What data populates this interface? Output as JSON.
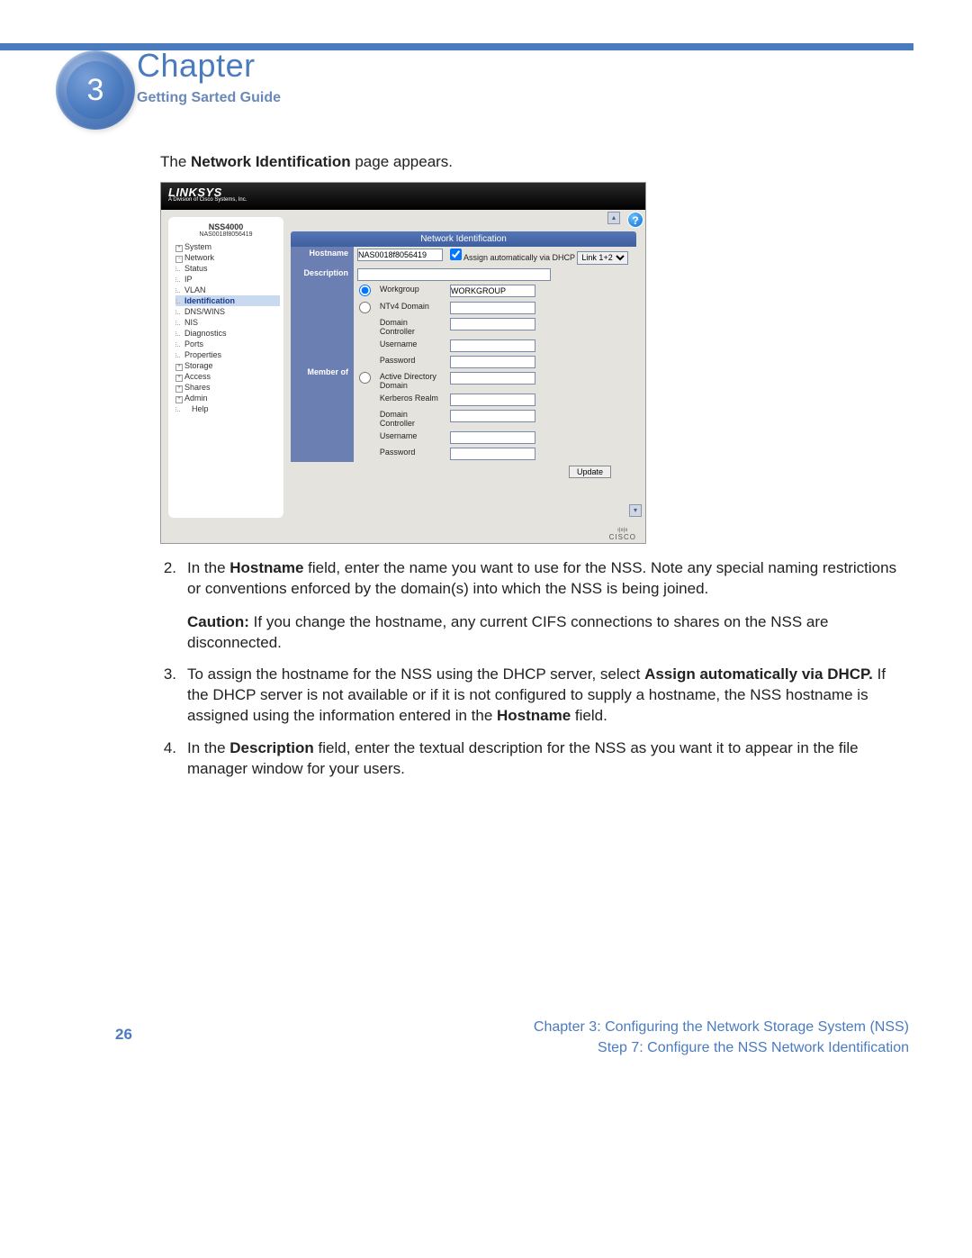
{
  "header": {
    "chapter_label": "Chapter",
    "chapter_number": "3",
    "subtitle": "Getting Sarted Guide"
  },
  "intro": {
    "pre": "The ",
    "bold": "Network Identification",
    "post": " page appears."
  },
  "screenshot": {
    "brand": "LINKSYS",
    "brand_tag": "A Division of Cisco Systems, Inc.",
    "device": "NSS4000",
    "device_sub": "NAS0018f8056419",
    "help_symbol": "?",
    "nav": {
      "system": "System",
      "network": "Network",
      "status": "Status",
      "ip": "IP",
      "vlan": "VLAN",
      "identification": "Identification",
      "dnswins": "DNS/WINS",
      "nis": "NIS",
      "diagnostics": "Diagnostics",
      "ports": "Ports",
      "properties": "Properties",
      "storage": "Storage",
      "access": "Access",
      "shares": "Shares",
      "admin": "Admin",
      "help": "Help"
    },
    "panel_title": "Network Identification",
    "form": {
      "hostname_label": "Hostname",
      "hostname_value": "NAS0018f8056419",
      "assign_auto": "Assign automatically via DHCP",
      "dhcp_select": "Link 1+2",
      "description_label": "Description",
      "description_value": "",
      "member_of_label": "Member of",
      "workgroup_label": "Workgroup",
      "workgroup_value": "WORKGROUP",
      "ntv4_label": "NTv4 Domain",
      "dc_label": "Domain Controller",
      "username_label": "Username",
      "password_label": "Password",
      "ad_label": "Active Directory Domain",
      "kerberos_label": "Kerberos Realm",
      "update_btn": "Update"
    },
    "cisco": "CISCO",
    "cisco_bars": "ı|ıı|ıı"
  },
  "paragraphs": {
    "p2": {
      "num": "2.",
      "t1": "In the ",
      "b1": "Hostname",
      "t2": " field, enter the name you want to use for the NSS. Note any special naming restrictions or conventions enforced by the domain(s) into which the NSS is being joined."
    },
    "caution": {
      "b1": "Caution:",
      "t1": " If you change the hostname, any current CIFS connections to shares on the NSS are disconnected."
    },
    "p3": {
      "num": "3.",
      "t1": "To assign the hostname for the NSS using the DHCP server, select ",
      "b1": "Assign automatically via DHCP.",
      "t2": " If the DHCP server is not available or if it is not configured to supply a hostname, the NSS hostname is assigned using the information entered in the ",
      "b2": "Hostname",
      "t3": " field."
    },
    "p4": {
      "num": "4.",
      "t1": "In the ",
      "b1": "Description",
      "t2": " field, enter the textual description for the NSS as you want it to appear in the file manager window for your users."
    }
  },
  "footer": {
    "page_num": "26",
    "line1": "Chapter 3: Configuring the Network Storage System (NSS)",
    "line2": "Step 7: Configure the NSS Network Identification"
  }
}
